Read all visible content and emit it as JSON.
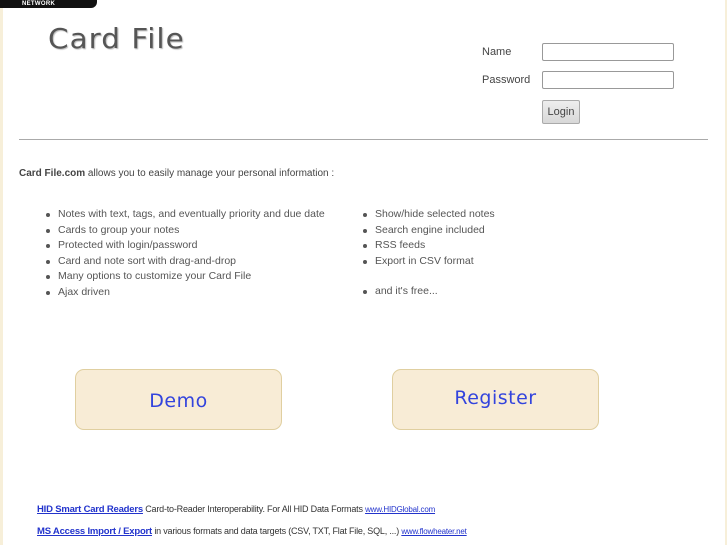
{
  "network_tab": {
    "label": "NETWORK"
  },
  "header": {
    "logo": "Card File"
  },
  "login": {
    "name_label": "Name",
    "name_value": "",
    "password_label": "Password",
    "password_value": "",
    "login_button": "Login"
  },
  "intro": {
    "site_name": "Card File.com",
    "text": " allows you to easily manage your personal information :"
  },
  "features": {
    "left": [
      "Notes with text, tags, and eventually priority and due date",
      "Cards to group your notes",
      "Protected with login/password",
      "Card and note sort with drag-and-drop",
      "Many options to customize your Card File",
      "Ajax driven"
    ],
    "right": [
      "Show/hide selected notes",
      "Search engine included",
      "RSS feeds",
      "Export in CSV format"
    ],
    "free": "and it's free..."
  },
  "actions": {
    "demo": "Demo",
    "register": "Register"
  },
  "ads": [
    {
      "title": "HID Smart Card Readers",
      "text": " Card-to-Reader Interoperability. For All HID Data Formats ",
      "url": "www.HIDGlobal.com"
    },
    {
      "title": "MS Access Import / Export",
      "text": " in various formats and data targets (CSV, TXT, Flat File, SQL, ...) ",
      "url": "www.flowheater.net"
    }
  ],
  "colors": {
    "button_bg": "#f8ecd6",
    "button_text": "#3344dd",
    "link": "#2233cc",
    "edge": "#f7efd9"
  }
}
